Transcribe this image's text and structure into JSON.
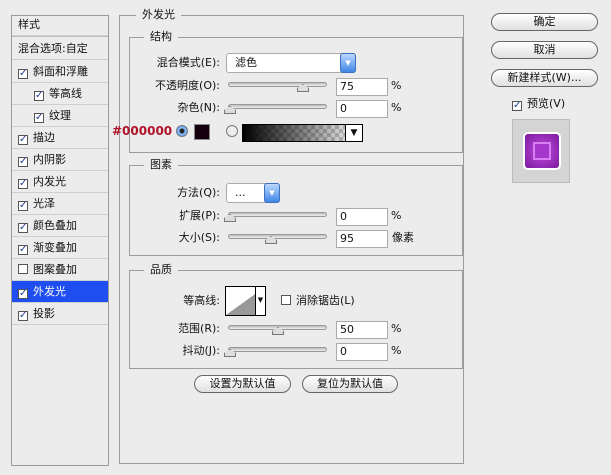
{
  "sidebar": {
    "header": "样式",
    "blend_options": "混合选项:自定",
    "items": [
      {
        "label": "斜面和浮雕",
        "checked": true
      },
      {
        "label": "等高线",
        "checked": true
      },
      {
        "label": "纹理",
        "checked": true
      },
      {
        "label": "描边",
        "checked": true
      },
      {
        "label": "内阴影",
        "checked": true
      },
      {
        "label": "内发光",
        "checked": true
      },
      {
        "label": "光泽",
        "checked": true
      },
      {
        "label": "颜色叠加",
        "checked": true
      },
      {
        "label": "渐变叠加",
        "checked": true
      },
      {
        "label": "图案叠加",
        "checked": false
      },
      {
        "label": "外发光",
        "checked": true,
        "selected": true
      },
      {
        "label": "投影",
        "checked": true
      }
    ]
  },
  "main": {
    "title": "外发光",
    "structure": {
      "title": "结构",
      "blend_mode_label": "混合模式(E):",
      "blend_mode": "滤色",
      "opacity_label": "不透明度(O):",
      "opacity": "75",
      "opacity_unit": "%",
      "noise_label": "杂色(N):",
      "noise": "0",
      "noise_unit": "%",
      "color_hex": "#000000",
      "swatch_color": "#12000f"
    },
    "elements": {
      "title": "图素",
      "technique_label": "方法(Q):",
      "technique": "...",
      "spread_label": "扩展(P):",
      "spread": "0",
      "spread_unit": "%",
      "size_label": "大小(S):",
      "size": "95",
      "size_unit": "像素"
    },
    "quality": {
      "title": "品质",
      "contour_label": "等高线:",
      "antialias_label": "消除锯齿(L)",
      "antialias": false,
      "range_label": "范围(R):",
      "range": "50",
      "range_unit": "%",
      "jitter_label": "抖动(J):",
      "jitter": "0",
      "jitter_unit": "%"
    },
    "make_default": "设置为默认值",
    "reset_default": "复位为默认值"
  },
  "buttons": {
    "ok": "确定",
    "cancel": "取消",
    "new_style": "新建样式(W)...",
    "preview_label": "预览(V)",
    "preview": true
  }
}
